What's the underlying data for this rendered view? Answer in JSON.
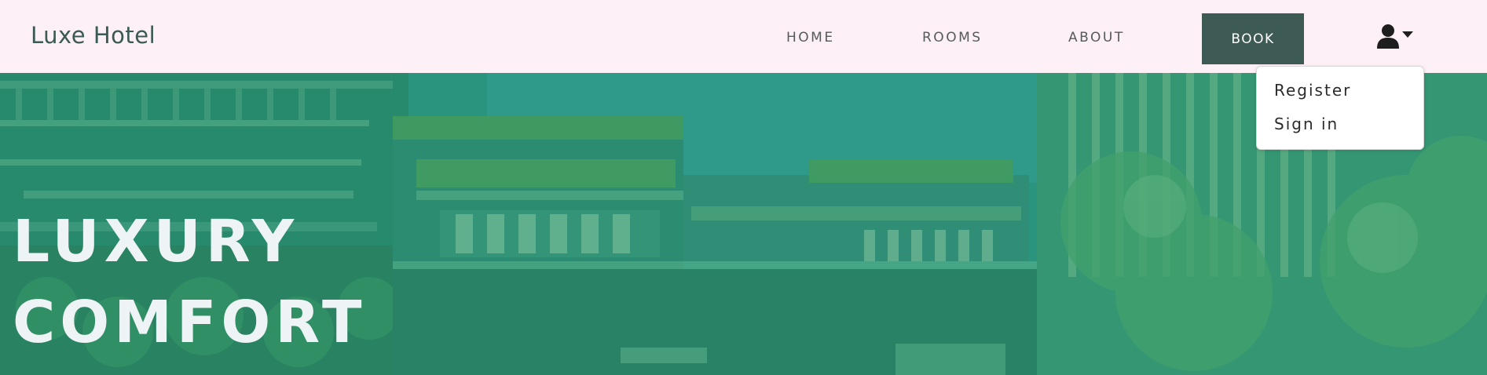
{
  "brand": {
    "name": "Luxe Hotel"
  },
  "nav": {
    "home": "HOME",
    "rooms": "ROOMS",
    "about": "ABOUT",
    "book": "BOOK"
  },
  "user_menu": {
    "icon": "user-icon",
    "caret_icon": "caret-down-icon",
    "items": [
      "Register",
      "Sign in"
    ]
  },
  "hero": {
    "line1": "LUXURY",
    "line2": "COMFORT"
  },
  "colors": {
    "navbar_bg": "#fdf0f6",
    "brand_text": "#3c5a55",
    "book_button_bg": "#3e5a55",
    "hero_overlay": "#2e8f77",
    "hero_text": "#eef3f6"
  }
}
